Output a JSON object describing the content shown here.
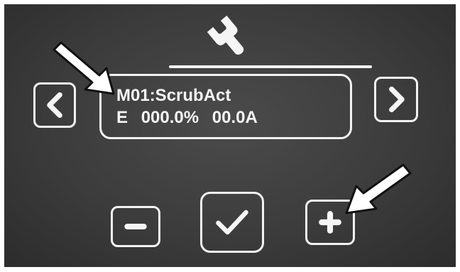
{
  "header": {
    "icon": "wrench-icon"
  },
  "display": {
    "mode_label": "M01:ScrubAct",
    "status": {
      "flag": "E",
      "percent": "000.0%",
      "current": "00.0A"
    }
  },
  "nav": {
    "prev_icon": "chevron-left-icon",
    "next_icon": "chevron-right-icon"
  },
  "controls": {
    "minus_icon": "minus-icon",
    "confirm_icon": "check-icon",
    "plus_icon": "plus-icon"
  },
  "colors": {
    "screen_bg": "#3c3c3c",
    "foreground": "#f2f2f2"
  }
}
